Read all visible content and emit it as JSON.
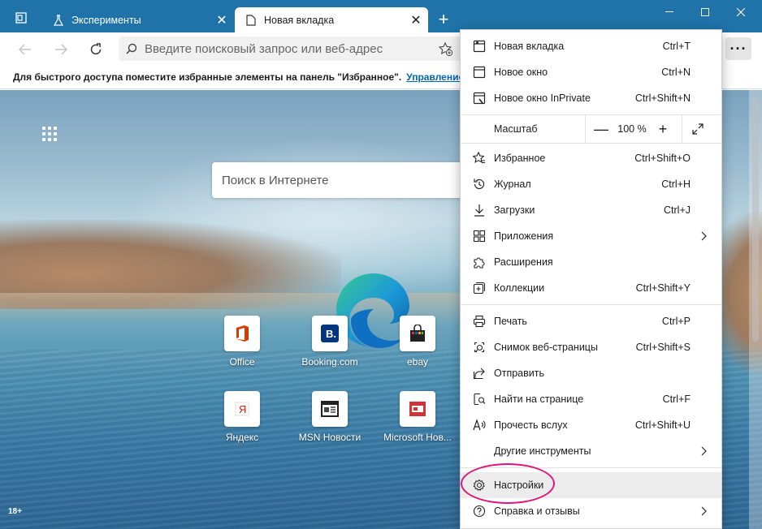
{
  "tabs": {
    "inactive_title": "Эксперименты",
    "active_title": "Новая вкладка",
    "close_glyph": "✕",
    "new_tab_glyph": "+"
  },
  "window": {
    "minimize": "—",
    "maximize": "☐",
    "close": "✕"
  },
  "address_bar": {
    "placeholder": "Введите поисковый запрос или веб-адрес",
    "more": "···"
  },
  "favorites_bar": {
    "message": "Для быстрого доступа поместите избранные элементы на панель \"Избранное\".",
    "link": "Управление изб"
  },
  "new_tab_page": {
    "search_placeholder": "Поиск в Интернете",
    "tiles": [
      {
        "label": "Office"
      },
      {
        "label": "Booking.com"
      },
      {
        "label": "ebay"
      },
      {
        "label": "Яндекс"
      },
      {
        "label": "MSN Новости"
      },
      {
        "label": "Microsoft Нов..."
      }
    ],
    "age_label": "18+"
  },
  "menu": {
    "items": [
      {
        "label": "Новая вкладка",
        "shortcut": "Ctrl+T",
        "icon": "new-tab-icon"
      },
      {
        "label": "Новое окно",
        "shortcut": "Ctrl+N",
        "icon": "new-window-icon"
      },
      {
        "label": "Новое окно InPrivate",
        "shortcut": "Ctrl+Shift+N",
        "icon": "inprivate-icon"
      },
      {
        "label": "Избранное",
        "shortcut": "Ctrl+Shift+O",
        "icon": "favorites-icon"
      },
      {
        "label": "Журнал",
        "shortcut": "Ctrl+H",
        "icon": "history-icon"
      },
      {
        "label": "Загрузки",
        "shortcut": "Ctrl+J",
        "icon": "downloads-icon"
      },
      {
        "label": "Приложения",
        "shortcut": "",
        "icon": "apps-icon"
      },
      {
        "label": "Расширения",
        "shortcut": "",
        "icon": "extensions-icon"
      },
      {
        "label": "Коллекции",
        "shortcut": "Ctrl+Shift+Y",
        "icon": "collections-icon"
      },
      {
        "label": "Печать",
        "shortcut": "Ctrl+P",
        "icon": "print-icon"
      },
      {
        "label": "Снимок веб-страницы",
        "shortcut": "Ctrl+Shift+S",
        "icon": "web-capture-icon"
      },
      {
        "label": "Отправить",
        "shortcut": "",
        "icon": "share-icon"
      },
      {
        "label": "Найти на странице",
        "shortcut": "Ctrl+F",
        "icon": "find-icon"
      },
      {
        "label": "Прочесть вслух",
        "shortcut": "Ctrl+Shift+U",
        "icon": "read-aloud-icon"
      },
      {
        "label": "Другие инструменты",
        "shortcut": "",
        "icon": ""
      },
      {
        "label": "Настройки",
        "shortcut": "",
        "icon": "settings-icon"
      },
      {
        "label": "Справка и отзывы",
        "shortcut": "",
        "icon": "help-icon"
      }
    ],
    "zoom": {
      "label": "Масштаб",
      "value": "100 %",
      "minus": "—",
      "plus": "+"
    }
  },
  "colors": {
    "titlebar": "#1f73a8",
    "highlight_circle": "#e0147a",
    "link": "#0066b4"
  }
}
